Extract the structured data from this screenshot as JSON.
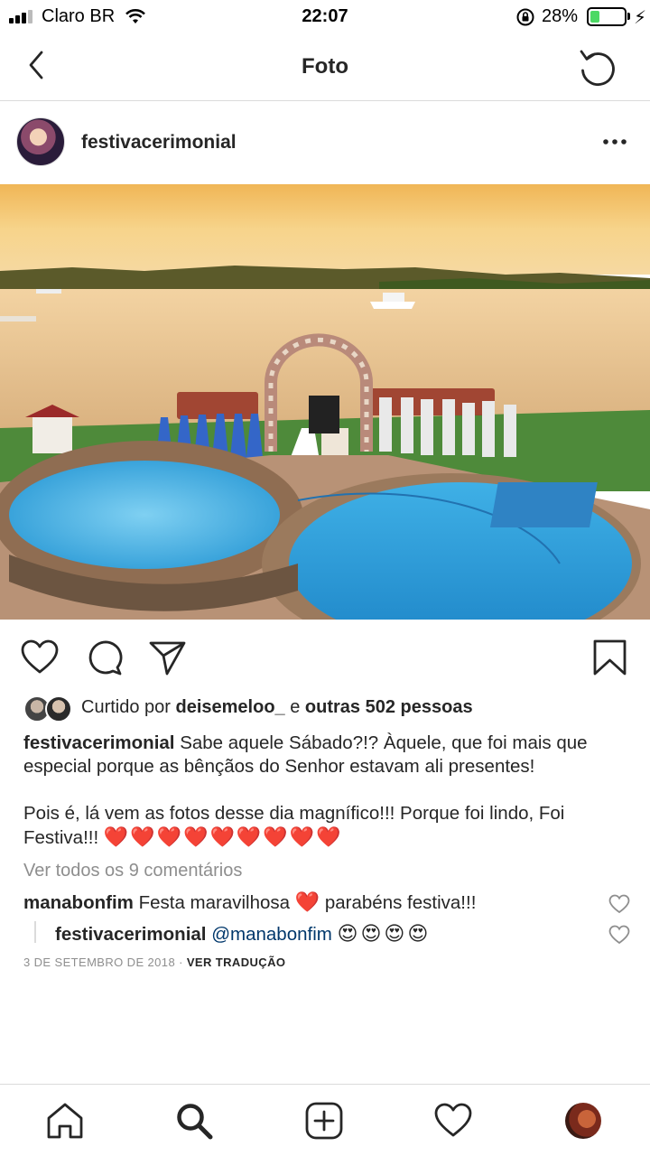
{
  "status_bar": {
    "carrier": "Claro BR",
    "time": "22:07",
    "battery_percent": "28%",
    "battery_level": 0.28
  },
  "nav": {
    "title": "Foto",
    "back_icon": "chevron-left-icon",
    "refresh_icon": "refresh-icon"
  },
  "post": {
    "username": "festivacerimonial",
    "more_icon": "more-horizontal-icon"
  },
  "likes": {
    "prefix": "Curtido por",
    "user": "deisemeloo_",
    "joiner": "e",
    "others": "outras 502 pessoas"
  },
  "caption": {
    "username": "festivacerimonial",
    "text1": "Sabe aquele Sábado?!? Àquele, que foi mais que especial porque as bênçãos do Senhor estavam ali presentes!",
    "text2": "Pois é, lá vem as fotos desse dia magnífico!!! Porque foi lindo, Foi Festiva!!!",
    "hearts": "❤️❤️❤️❤️❤️❤️❤️❤️❤️"
  },
  "view_all_comments": "Ver todos os 9 comentários",
  "comments": [
    {
      "username": "manabonfim",
      "text_before": "Festa maravilhosa",
      "emoji": "❤️",
      "text_after": "parabéns festiva!!!"
    },
    {
      "username": "festivacerimonial",
      "mention": "@manabonfim",
      "emoji": "😍😍😍😍"
    }
  ],
  "meta": {
    "date": "3 DE SETEMBRO DE 2018",
    "separator": "·",
    "translate": "VER TRADUÇÃO"
  },
  "colors": {
    "text": "#262626",
    "secondary": "#8e8e8e",
    "heart": "#e0102a",
    "mention": "#00376b",
    "battery_fill": "#4cd964"
  },
  "tabbar": [
    "home-icon",
    "search-icon",
    "new-post-icon",
    "activity-heart-icon",
    "profile-avatar"
  ]
}
